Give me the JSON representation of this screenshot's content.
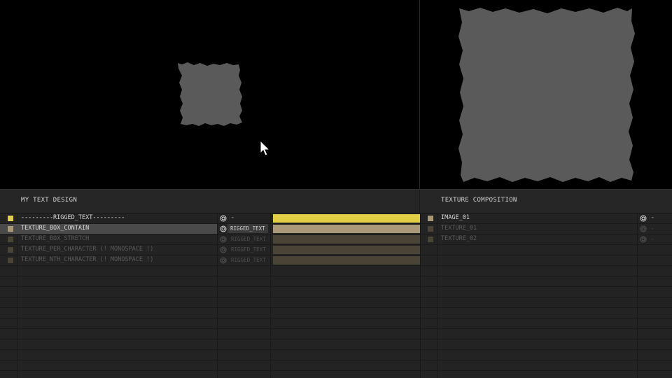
{
  "left_panel": {
    "title": "MY TEXT DESIGN",
    "layers": [
      {
        "name": "---------RIGGED_TEXT---------",
        "parent": "-",
        "swatch_color": "#e3cf46",
        "bar_color": "#e3cf46",
        "dim": false,
        "selected": false
      },
      {
        "name": "TEXTURE_BOX_CONTAIN",
        "parent": "RIGGED_TEXT",
        "swatch_color": "#a99978",
        "bar_color": "#a99978",
        "dim": false,
        "selected": true
      },
      {
        "name": "TEXTURE_BOX_STRETCH",
        "parent": "RIGGED_TEXT",
        "swatch_color": "#4a4436",
        "bar_color": "#4a4436",
        "dim": true,
        "selected": false
      },
      {
        "name": "TEXTURE_PER_CHARACTER (! MONOSPACE !)",
        "parent": "RIGGED_TEXT",
        "swatch_color": "#4a4436",
        "bar_color": "#4a4436",
        "dim": true,
        "selected": false
      },
      {
        "name": "TEXTURE_NTH_CHARACTER (! MONOSPACE !)",
        "parent": "RIGGED_TEXT",
        "swatch_color": "#4a4436",
        "bar_color": "#4a4436",
        "dim": true,
        "selected": false
      }
    ]
  },
  "right_panel": {
    "title": "TEXTURE COMPOSITION",
    "layers": [
      {
        "name": "IMAGE_01",
        "parent": "-",
        "swatch_color": "#a99978",
        "dim": false
      },
      {
        "name": "TEXTURE_01",
        "parent": "-",
        "swatch_color": "#4a4436",
        "dim": true
      },
      {
        "name": "TEXTURE_02",
        "parent": "-",
        "swatch_color": "#4a4436",
        "dim": true
      }
    ]
  },
  "icons": {
    "parent_link": "pick-whip-spiral-icon",
    "cursor": "mouse-pointer-icon"
  },
  "colors": {
    "viewer_background": "#000000",
    "texture_grey": "#5a5a5a",
    "accent_yellow": "#e3cf46",
    "accent_tan": "#a99978"
  }
}
